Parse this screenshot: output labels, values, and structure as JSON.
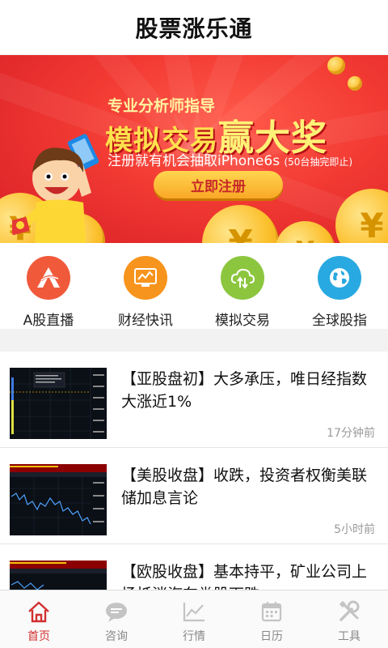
{
  "header": {
    "title": "股票涨乐通"
  },
  "banner": {
    "line1": "专业分析师指导",
    "line2_a": "模拟交易",
    "line2_b": "赢大奖",
    "line3": "注册就有机会抽取iPhone6s",
    "line3_note": "(50台抽完即止)",
    "button": "立即注册",
    "coin_symbol": "¥",
    "colors": {
      "bg": "#e8262b",
      "accent": "#ffe14d"
    }
  },
  "quick_nav": [
    {
      "label": "A股直播",
      "icon": "a-share-live-icon",
      "color": "#f05a3b"
    },
    {
      "label": "财经快讯",
      "icon": "finance-news-icon",
      "color": "#f7941d"
    },
    {
      "label": "模拟交易",
      "icon": "cloud-trade-icon",
      "color": "#8cc63f"
    },
    {
      "label": "全球股指",
      "icon": "globe-icon",
      "color": "#29a9e1"
    }
  ],
  "news": [
    {
      "title": "【亚股盘初】大多承压，唯日经指数大涨近1%",
      "time": "17分钟前"
    },
    {
      "title": "【美股收盘】收跌，投资者权衡美联储加息言论",
      "time": "5小时前"
    },
    {
      "title": "【欧股收盘】基本持平，矿业公司上扬抵消汽车类股下跌",
      "time": ""
    }
  ],
  "tabs": [
    {
      "label": "首页",
      "icon": "home-icon",
      "active": true
    },
    {
      "label": "咨询",
      "icon": "chat-icon",
      "active": false
    },
    {
      "label": "行情",
      "icon": "chart-icon",
      "active": false
    },
    {
      "label": "日历",
      "icon": "calendar-icon",
      "active": false
    },
    {
      "label": "工具",
      "icon": "tools-icon",
      "active": false
    }
  ]
}
